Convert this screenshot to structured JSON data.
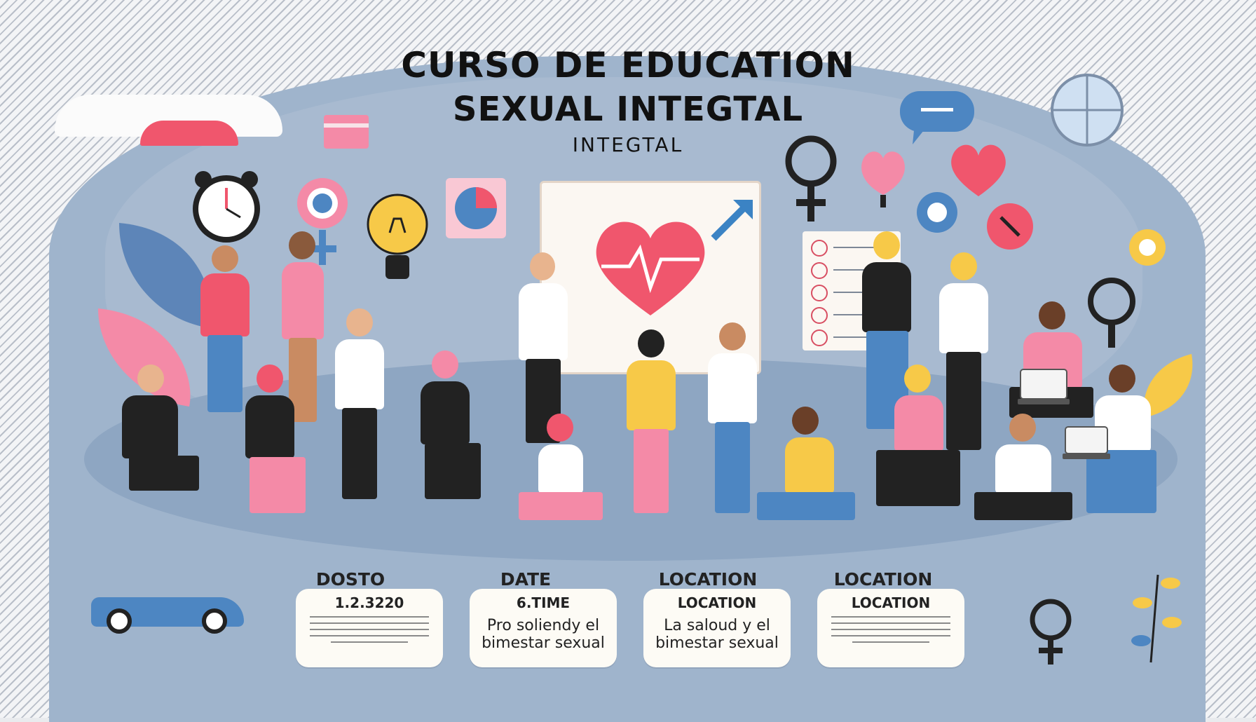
{
  "header": {
    "title_line1": "CURSO DE EDUCATION",
    "title_line2": "SEXUAL INTEGTAL",
    "title_line3": "INTEGTAL"
  },
  "info": [
    {
      "label": "DOSTO",
      "line1": "1.2.3220",
      "line2": "",
      "line3": ""
    },
    {
      "label": "DATE",
      "line1": "6.TIME",
      "line2": "Pro soliendy el",
      "line3": "bimestar sexual"
    },
    {
      "label": "LOCATION",
      "line1": "LOCATION",
      "line2": "La saloud y el",
      "line3": "bimestar sexual"
    },
    {
      "label": "LOCATION",
      "line1": "LOCATION",
      "line2": "",
      "line3": ""
    }
  ],
  "colors": {
    "pink": "#f0566d",
    "blue": "#4d86c2",
    "yellow": "#f7c948",
    "dark": "#222222",
    "background": "#9fb4cc"
  },
  "icons": [
    "alarm-clock-icon",
    "female-symbol-icon",
    "lightbulb-icon",
    "pie-chart-icon",
    "heart-pulse-icon",
    "male-arrow-icon",
    "speech-bubble-icon",
    "globe-icon",
    "heart-icon",
    "gender-symbol-icon",
    "gear-icon",
    "leaf-icon",
    "book-icon",
    "laptop-icon"
  ]
}
